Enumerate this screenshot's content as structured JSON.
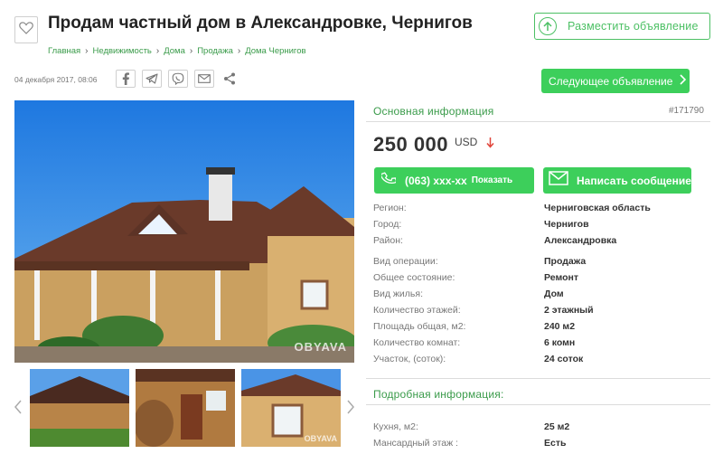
{
  "header": {
    "title": "Продам частный дом в Александровке, Чернигов",
    "post_ad_label": "Разместить объявление",
    "breadcrumbs": [
      "Главная",
      "Недвижимость",
      "Дома",
      "Продажа",
      "Дома Чернигов"
    ]
  },
  "meta": {
    "date": "04 декабря 2017, 08:06",
    "share_icons": [
      "facebook-icon",
      "telegram-icon",
      "viber-icon",
      "email-icon",
      "share-icon"
    ],
    "next_ad_label": "Следующее объявление"
  },
  "gallery": {
    "watermark": "OBYAVA"
  },
  "main_info": {
    "header": "Основная информация",
    "ad_id": "#171790",
    "price": "250 000",
    "currency": "USD",
    "phone": "(063) xxx-xx",
    "phone_show": "Показать",
    "message_label": "Написать сообщение",
    "properties": [
      {
        "key": "Регион:",
        "value": "Черниговская область"
      },
      {
        "key": "Город:",
        "value": "Чернигов"
      },
      {
        "key": "Район:",
        "value": "Александровка"
      },
      {
        "key": "Вид операции:",
        "value": "Продажа"
      },
      {
        "key": "Общее состояние:",
        "value": "Ремонт"
      },
      {
        "key": "Вид жилья:",
        "value": "Дом"
      },
      {
        "key": "Количество этажей:",
        "value": "2 этажный"
      },
      {
        "key": "Площадь общая, м2:",
        "value": "240 м2"
      },
      {
        "key": "Количество комнат:",
        "value": "6 комн"
      },
      {
        "key": "Участок, (соток):",
        "value": "24 соток"
      }
    ]
  },
  "detail_info": {
    "header": "Подробная информация:",
    "properties": [
      {
        "key": "Кухня, м2:",
        "value": "25 м2"
      },
      {
        "key": "Мансардный этаж :",
        "value": "Есть"
      }
    ]
  },
  "colors": {
    "accent_green": "#3dcf5b",
    "link_green": "#3a9b4a",
    "price_down_red": "#e0443a"
  }
}
